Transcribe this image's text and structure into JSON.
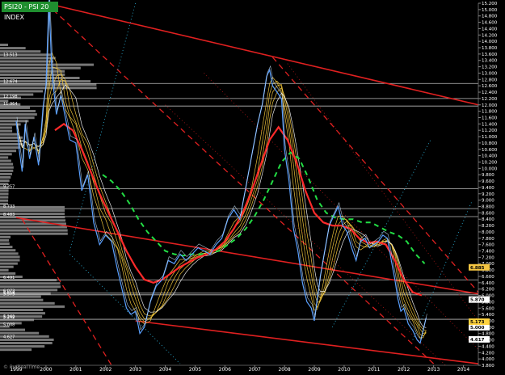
{
  "header": {
    "title": "PSI20 - PSI 20 INDEX"
  },
  "branding": {
    "text": "© ProRealTime"
  },
  "colors": {
    "background": "#000000",
    "price": "#5aa0ff",
    "ma_thin": "#ffd23f",
    "ma_red": "#ff2a2a",
    "ma_green": "#22dd44",
    "channel_red": "#e02020",
    "teal_dotted": "#2aaad0",
    "horizontal": "#bbbbbb",
    "volume_bars": "#8c8c8c",
    "label_box": "#ffffff",
    "title_badge": "#1f8f2f"
  },
  "chart_data": {
    "type": "line",
    "title": "PSI20 - PSI 20 INDEX",
    "x_axis": {
      "tick_labels": [
        "1999",
        "2000",
        "2001",
        "2002",
        "2003",
        "2004",
        "2005",
        "2006",
        "2007",
        "2008",
        "2009",
        "2010",
        "2011",
        "2012",
        "2013",
        "2014"
      ],
      "range": [
        1999.0,
        2014.5
      ]
    },
    "y_axis": {
      "tick_labels": [
        "3.800",
        "4.000",
        "4.200",
        "4.400",
        "4.600",
        "4.800",
        "5.000",
        "5.200",
        "5.400",
        "5.600",
        "5.800",
        "6.000",
        "6.200",
        "6.400",
        "6.600",
        "6.800",
        "7.000",
        "7.200",
        "7.400",
        "7.600",
        "7.800",
        "8.000",
        "8.200",
        "8.400",
        "8.600",
        "8.800",
        "9.000",
        "9.200",
        "9.400",
        "9.600",
        "9.800",
        "10.000",
        "10.200",
        "10.400",
        "10.600",
        "10.800",
        "11.000",
        "11.200",
        "11.400",
        "11.600",
        "11.800",
        "12.000",
        "12.200",
        "12.400",
        "12.600",
        "12.800",
        "13.000",
        "13.200",
        "13.400",
        "13.600",
        "13.800",
        "14.000",
        "14.200",
        "14.400",
        "14.600",
        "14.800",
        "15.000",
        "15.200"
      ],
      "range": [
        3.8,
        15.2
      ],
      "position": "right"
    },
    "grid": false,
    "legend": "none",
    "series": [
      {
        "role": "price",
        "x": [
          1999.0,
          1999.1,
          1999.2,
          1999.3,
          1999.45,
          1999.6,
          1999.75,
          1999.9,
          2000.0,
          2000.1,
          2000.2,
          2000.35,
          2000.5,
          2000.65,
          2000.8,
          2001.0,
          2001.2,
          2001.4,
          2001.6,
          2001.8,
          2002.0,
          2002.2,
          2002.4,
          2002.55,
          2002.7,
          2002.85,
          2003.0,
          2003.15,
          2003.3,
          2003.5,
          2003.7,
          2003.9,
          2004.1,
          2004.3,
          2004.5,
          2004.7,
          2004.9,
          2005.1,
          2005.3,
          2005.5,
          2005.7,
          2005.9,
          2006.1,
          2006.3,
          2006.5,
          2006.7,
          2006.9,
          2007.1,
          2007.25,
          2007.4,
          2007.5,
          2007.6,
          2007.75,
          2007.9,
          2008.0,
          2008.15,
          2008.3,
          2008.45,
          2008.6,
          2008.75,
          2008.9,
          2009.0,
          2009.1,
          2009.2,
          2009.35,
          2009.5,
          2009.65,
          2009.8,
          2009.95,
          2010.1,
          2010.25,
          2010.4,
          2010.55,
          2010.7,
          2010.85,
          2011.0,
          2011.15,
          2011.3,
          2011.45,
          2011.6,
          2011.7,
          2011.8,
          2011.9,
          2012.0,
          2012.15,
          2012.3,
          2012.45,
          2012.55,
          2012.65,
          2012.75
        ],
        "y": [
          11.5,
          10.6,
          9.9,
          11.4,
          10.3,
          11.0,
          10.1,
          11.9,
          12.6,
          15.3,
          13.0,
          11.7,
          12.3,
          11.6,
          10.9,
          10.8,
          9.3,
          9.8,
          8.3,
          7.6,
          7.9,
          7.7,
          6.8,
          6.2,
          5.6,
          5.4,
          5.5,
          4.8,
          5.0,
          5.8,
          6.3,
          6.5,
          7.1,
          7.0,
          7.3,
          7.1,
          7.3,
          7.5,
          7.4,
          7.3,
          7.6,
          7.8,
          8.4,
          8.7,
          8.4,
          9.4,
          10.4,
          11.4,
          12.0,
          12.9,
          13.1,
          12.6,
          12.4,
          12.2,
          10.6,
          9.6,
          8.1,
          7.4,
          6.4,
          5.8,
          5.6,
          5.2,
          5.9,
          6.6,
          7.4,
          8.2,
          8.5,
          8.8,
          8.2,
          8.0,
          7.5,
          7.1,
          7.7,
          7.8,
          7.5,
          7.6,
          7.7,
          7.9,
          7.8,
          7.0,
          6.5,
          5.9,
          5.5,
          5.6,
          5.1,
          4.9,
          4.6,
          4.5,
          4.9,
          5.3
        ]
      },
      {
        "role": "ma_red",
        "x": [
          2000.3,
          2000.6,
          2000.9,
          2001.2,
          2001.5,
          2001.8,
          2002.1,
          2002.4,
          2002.7,
          2003.0,
          2003.3,
          2003.6,
          2003.9,
          2004.2,
          2004.5,
          2004.8,
          2005.1,
          2005.4,
          2005.7,
          2006.0,
          2006.3,
          2006.6,
          2006.9,
          2007.2,
          2007.5,
          2007.8,
          2008.1,
          2008.4,
          2008.7,
          2009.0,
          2009.3,
          2009.6,
          2009.9,
          2010.2,
          2010.5,
          2010.8,
          2011.1,
          2011.4,
          2011.7,
          2012.0,
          2012.3,
          2012.6
        ],
        "y": [
          11.2,
          11.4,
          11.2,
          10.6,
          9.9,
          9.2,
          8.6,
          8.0,
          7.4,
          6.9,
          6.5,
          6.4,
          6.5,
          6.7,
          6.9,
          7.05,
          7.2,
          7.3,
          7.45,
          7.7,
          8.1,
          8.6,
          9.3,
          10.1,
          10.9,
          11.3,
          10.9,
          10.2,
          9.3,
          8.6,
          8.3,
          8.2,
          8.2,
          8.1,
          7.8,
          7.65,
          7.7,
          7.6,
          7.1,
          6.5,
          6.1,
          6.0
        ]
      },
      {
        "role": "ma_green",
        "x": [
          2001.9,
          2002.2,
          2002.5,
          2002.8,
          2003.1,
          2003.4,
          2003.7,
          2004.0,
          2004.3,
          2004.6,
          2004.9,
          2005.2,
          2005.5,
          2005.8,
          2006.1,
          2006.4,
          2006.7,
          2007.0,
          2007.3,
          2007.6,
          2007.9,
          2008.2,
          2008.5,
          2008.8,
          2009.1,
          2009.4,
          2009.7,
          2010.0,
          2010.3,
          2010.6,
          2010.9,
          2011.2,
          2011.5,
          2011.8,
          2012.1,
          2012.4,
          2012.7
        ],
        "y": [
          9.8,
          9.6,
          9.3,
          8.9,
          8.4,
          8.0,
          7.7,
          7.4,
          7.3,
          7.25,
          7.3,
          7.3,
          7.35,
          7.4,
          7.6,
          7.8,
          8.1,
          8.5,
          9.0,
          9.6,
          10.2,
          10.5,
          10.3,
          9.7,
          9.0,
          8.6,
          8.45,
          8.4,
          8.4,
          8.3,
          8.3,
          8.15,
          8.0,
          7.9,
          7.7,
          7.3,
          7.0
        ]
      }
    ],
    "price_labels": [
      "12.674",
      "13.513",
      "12.198",
      "11.964",
      "9.357",
      "8.733",
      "8.483",
      "6.491",
      "6.073",
      "6.019",
      "5.979",
      "5.249",
      "4.627",
      "5.262",
      "5.008"
    ],
    "highlight_labels": [
      "6.885",
      "5.870",
      "5.000",
      "5.173",
      "4.617"
    ],
    "horizontal_levels": [
      12.674,
      12.2,
      11.964,
      9.357,
      8.733,
      8.483,
      6.491,
      6.073,
      6.019,
      5.249
    ],
    "trend_lines": [
      {
        "style": "solid",
        "from": [
          2000.0,
          15.2
        ],
        "to": [
          2014.5,
          12.0
        ]
      },
      {
        "style": "solid",
        "from": [
          1999.0,
          8.45
        ],
        "to": [
          2014.5,
          6.05
        ]
      },
      {
        "style": "solid",
        "from": [
          2003.0,
          5.2
        ],
        "to": [
          2014.5,
          3.85
        ]
      },
      {
        "style": "dashed",
        "from": [
          2000.0,
          15.2
        ],
        "to": [
          2013.0,
          3.85
        ]
      },
      {
        "style": "dashed",
        "from": [
          2007.6,
          13.5
        ],
        "to": [
          2014.5,
          6.1
        ]
      },
      {
        "style": "dashed",
        "from": [
          1999.2,
          8.4
        ],
        "to": [
          2002.2,
          3.8
        ]
      }
    ]
  }
}
